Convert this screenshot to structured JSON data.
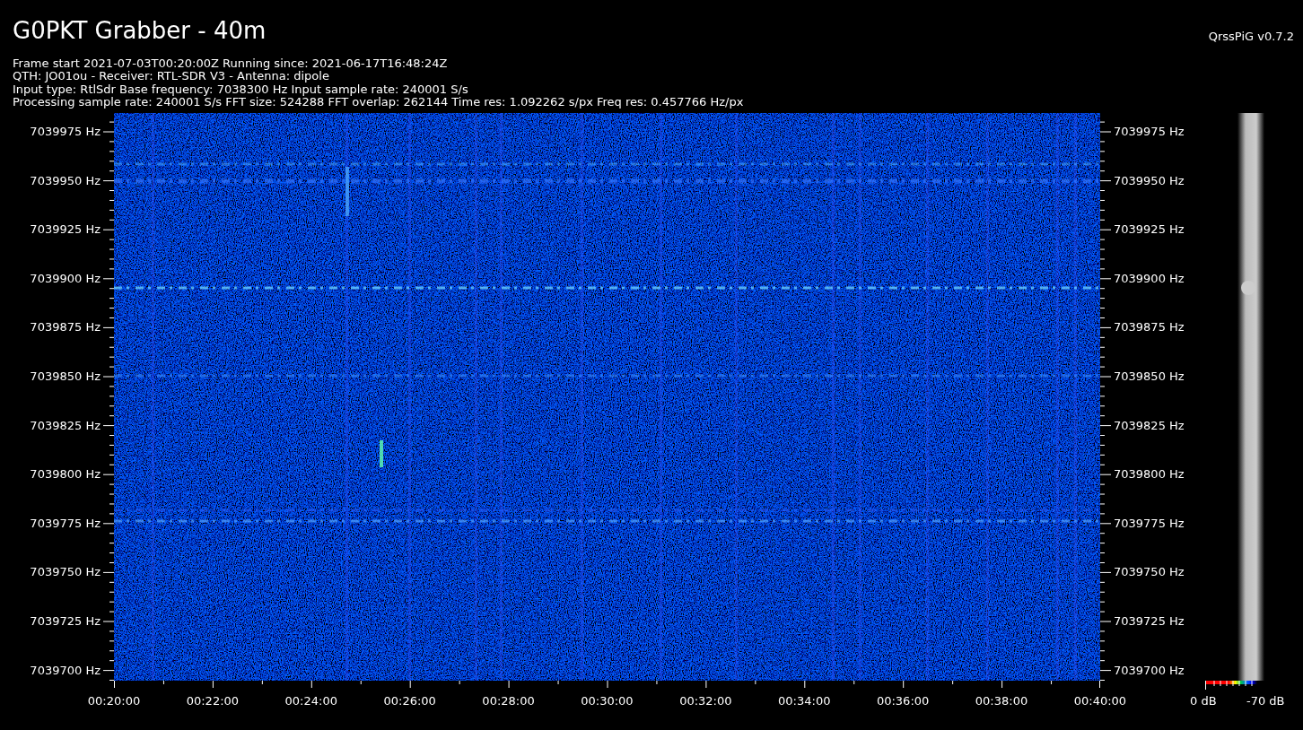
{
  "title": "G0PKT Grabber - 40m",
  "version": "QrssPiG v0.7.2",
  "info_lines": [
    "Frame start 2021-07-03T00:20:00Z Running since: 2021-06-17T16:48:24Z",
    "QTH: JO01ou - Receiver: RTL-SDR V3 - Antenna: dipole",
    "Input type: RtlSdr Base frequency: 7038300 Hz Input sample rate: 240001 S/s",
    "Processing sample rate: 240001 S/s FFT size: 524288 FFT overlap: 262144 Time res: 1.092262 s/px Freq res: 0.457766 Hz/px"
  ],
  "frequency_axis_left": [
    "7039975 Hz",
    "7039950 Hz",
    "7039925 Hz",
    "7039900 Hz",
    "7039875 Hz",
    "7039850 Hz",
    "7039825 Hz",
    "7039800 Hz",
    "7039775 Hz",
    "7039750 Hz",
    "7039725 Hz",
    "7039700 Hz"
  ],
  "frequency_axis_right": [
    "7039975 Hz",
    "7039950 Hz",
    "7039925 Hz",
    "7039900 Hz",
    "7039875 Hz",
    "7039850 Hz",
    "7039825 Hz",
    "7039800 Hz",
    "7039775 Hz",
    "7039750 Hz",
    "7039725 Hz",
    "7039700 Hz"
  ],
  "time_axis": [
    "00:20:00",
    "00:22:00",
    "00:24:00",
    "00:26:00",
    "00:28:00",
    "00:30:00",
    "00:32:00",
    "00:34:00",
    "00:36:00",
    "00:38:00",
    "00:40:00"
  ],
  "legend": {
    "max_label": "0 dB",
    "min_label": "-70 dB"
  }
}
